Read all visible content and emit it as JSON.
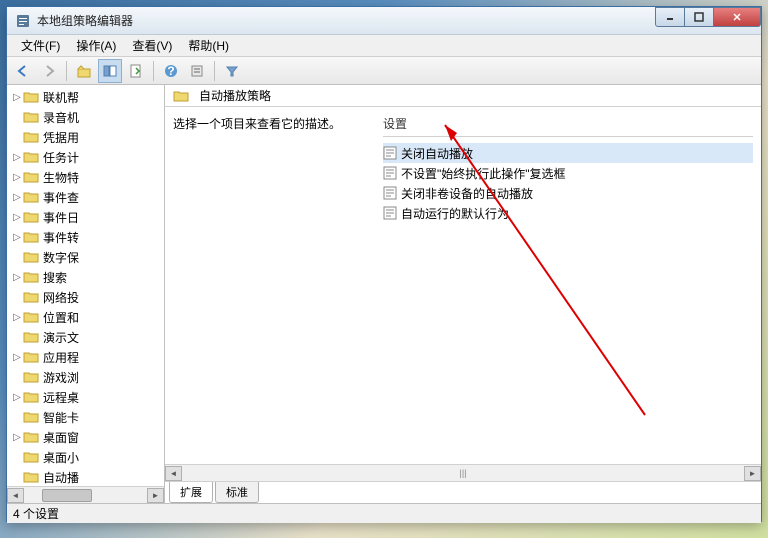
{
  "window": {
    "title": "本地组策略编辑器"
  },
  "menu": {
    "file": "文件(F)",
    "action": "操作(A)",
    "view": "查看(V)",
    "help": "帮助(H)"
  },
  "tree": {
    "items": [
      {
        "label": "联机帮",
        "exp": "▷"
      },
      {
        "label": "录音机",
        "exp": ""
      },
      {
        "label": "凭据用",
        "exp": ""
      },
      {
        "label": "任务计",
        "exp": "▷"
      },
      {
        "label": "生物特",
        "exp": "▷"
      },
      {
        "label": "事件查",
        "exp": "▷"
      },
      {
        "label": "事件日",
        "exp": "▷"
      },
      {
        "label": "事件转",
        "exp": "▷"
      },
      {
        "label": "数字保",
        "exp": ""
      },
      {
        "label": "搜索",
        "exp": "▷"
      },
      {
        "label": "网络投",
        "exp": ""
      },
      {
        "label": "位置和",
        "exp": "▷"
      },
      {
        "label": "演示文",
        "exp": ""
      },
      {
        "label": "应用程",
        "exp": "▷"
      },
      {
        "label": "游戏浏",
        "exp": ""
      },
      {
        "label": "远程桌",
        "exp": "▷"
      },
      {
        "label": "智能卡",
        "exp": ""
      },
      {
        "label": "桌面窗",
        "exp": "▷"
      },
      {
        "label": "桌面小",
        "exp": ""
      },
      {
        "label": "自动播",
        "exp": ""
      }
    ]
  },
  "path": {
    "current": "自动播放策略"
  },
  "description": {
    "hint": "选择一个项目来查看它的描述。"
  },
  "settings": {
    "header": "设置",
    "rows": [
      "关闭自动播放",
      "不设置\"始终执行此操作\"复选框",
      "关闭非卷设备的自动播放",
      "自动运行的默认行为"
    ]
  },
  "tabs": {
    "extended": "扩展",
    "standard": "标准"
  },
  "status": {
    "text": "4 个设置"
  }
}
